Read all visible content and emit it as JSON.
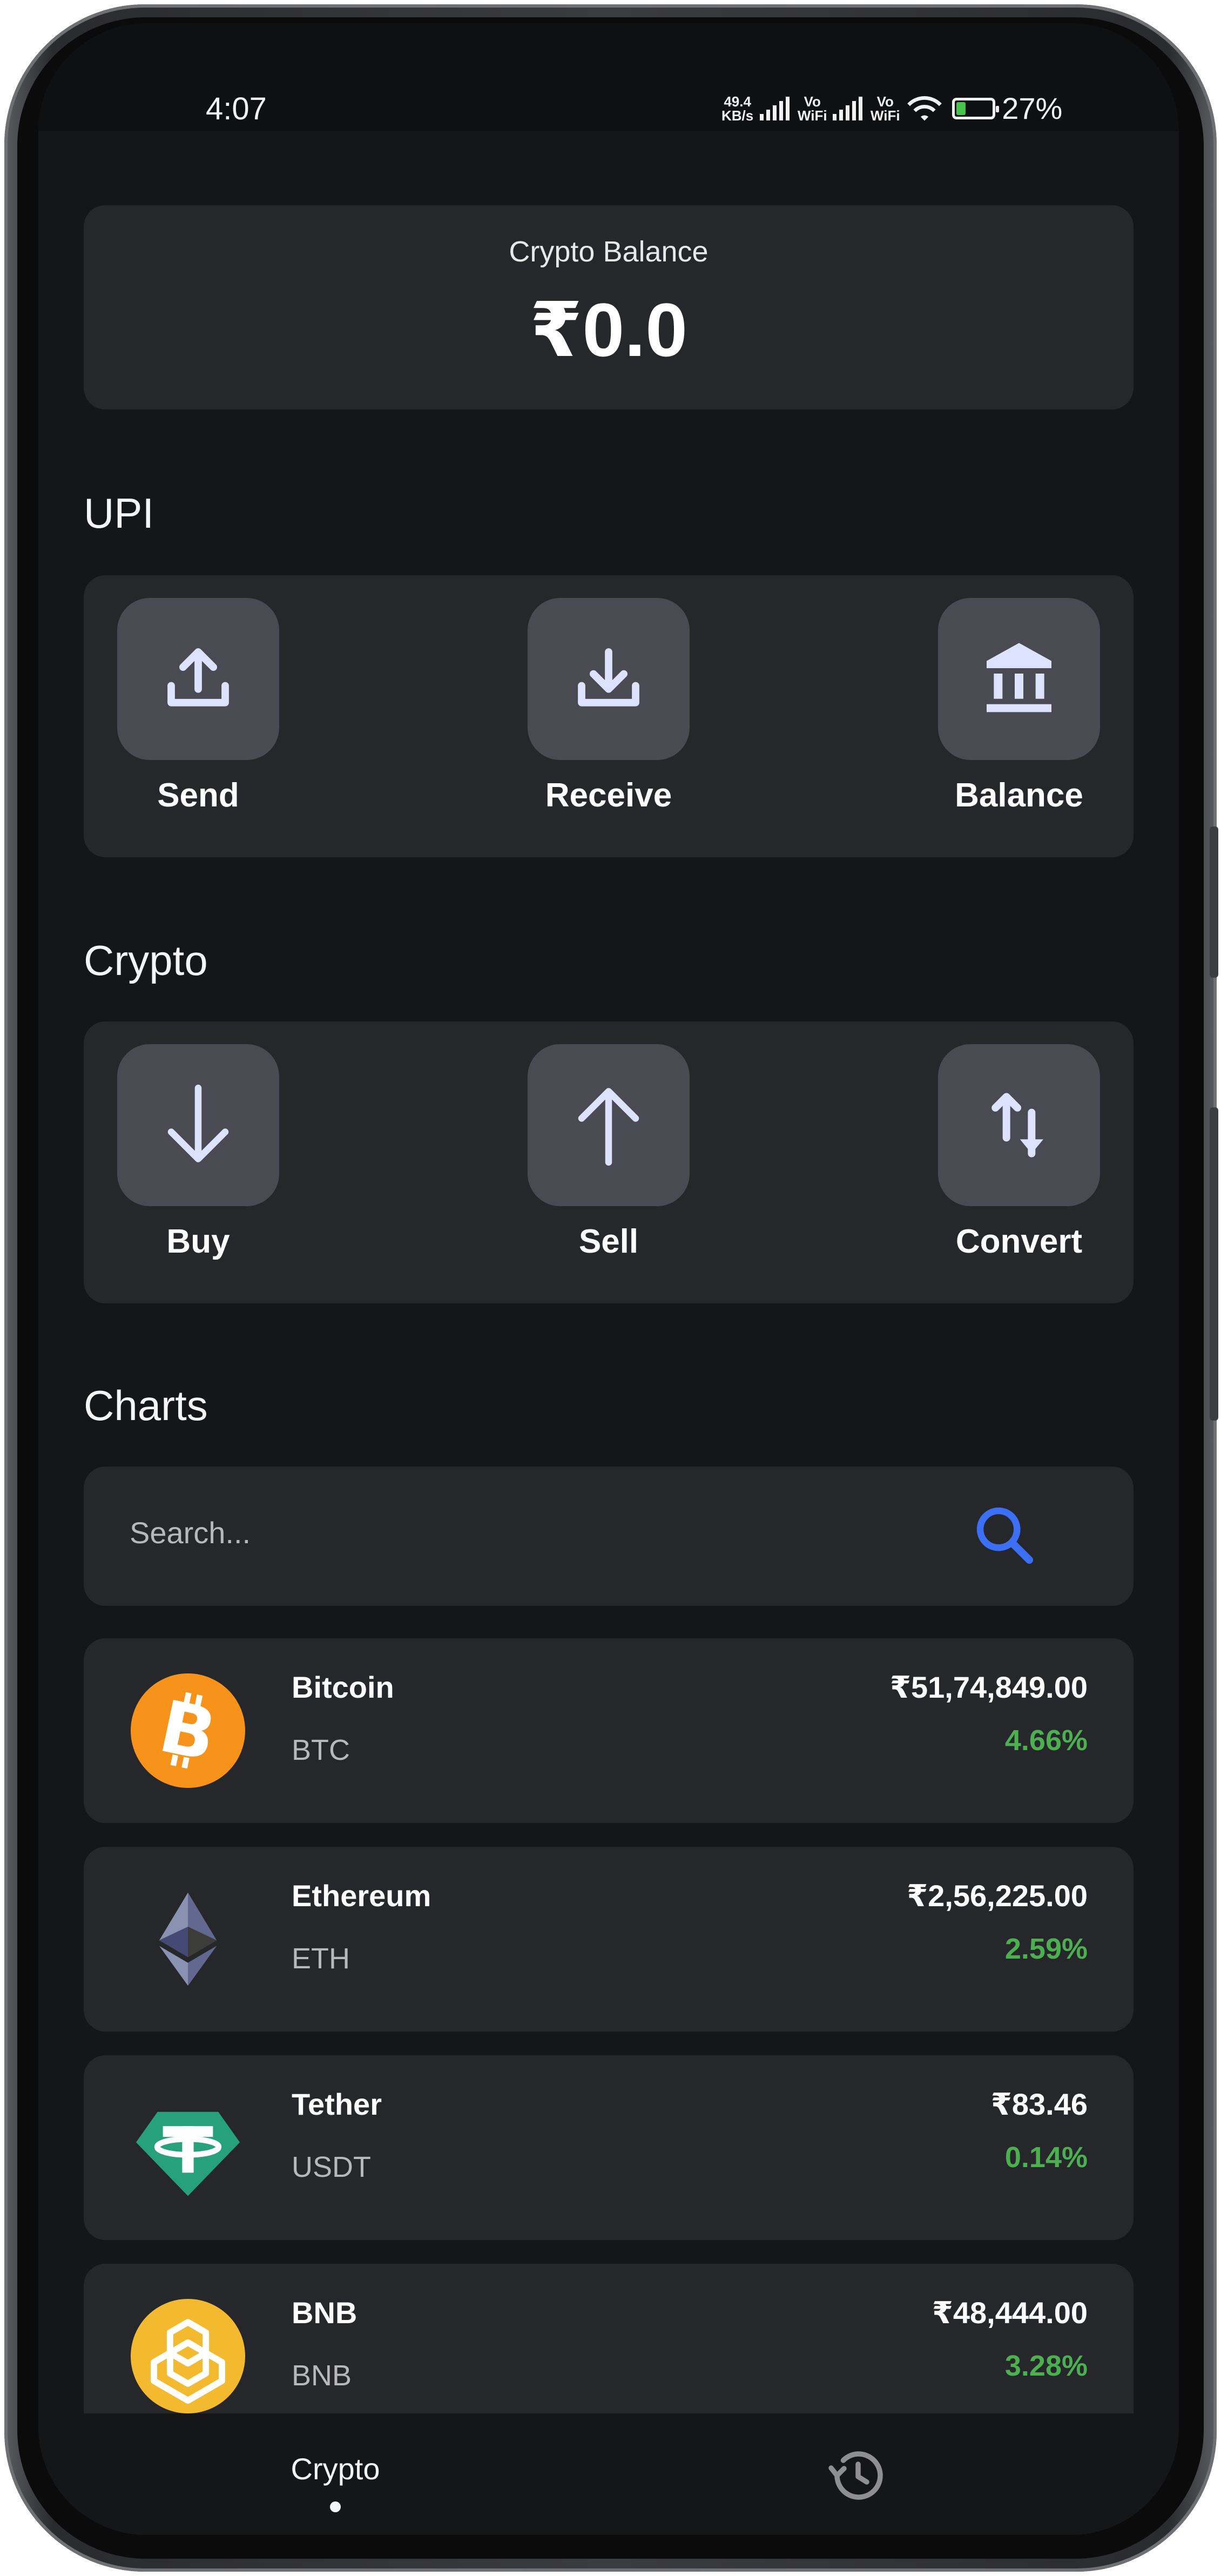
{
  "status_bar": {
    "time": "4:07",
    "net_speed_value": "49.4",
    "net_speed_unit": "KB/s",
    "sim1_label": "Vo WiFi",
    "sim2_label": "Vo WiFi",
    "battery_percent": "27%",
    "battery_level": 0.27
  },
  "balance": {
    "label": "Crypto Balance",
    "value": "₹0.0"
  },
  "upi": {
    "title": "UPI",
    "actions": [
      {
        "label": "Send",
        "icon": "upload-icon"
      },
      {
        "label": "Receive",
        "icon": "download-icon"
      },
      {
        "label": "Balance",
        "icon": "bank-icon"
      }
    ]
  },
  "crypto": {
    "title": "Crypto",
    "actions": [
      {
        "label": "Buy",
        "icon": "arrow-down-icon"
      },
      {
        "label": "Sell",
        "icon": "arrow-up-icon"
      },
      {
        "label": "Convert",
        "icon": "swap-vertical-icon"
      }
    ]
  },
  "charts": {
    "title": "Charts",
    "search_placeholder": "Search...",
    "coins": [
      {
        "name": "Bitcoin",
        "symbol": "BTC",
        "price": "₹51,74,849.00",
        "change": "4.66%",
        "icon": "bitcoin-icon"
      },
      {
        "name": "Ethereum",
        "symbol": "ETH",
        "price": "₹2,56,225.00",
        "change": "2.59%",
        "icon": "ethereum-icon"
      },
      {
        "name": "Tether",
        "symbol": "USDT",
        "price": "₹83.46",
        "change": "0.14%",
        "icon": "tether-icon"
      },
      {
        "name": "BNB",
        "symbol": "BNB",
        "price": "₹48,444.00",
        "change": "3.28%",
        "icon": "bnb-icon"
      }
    ]
  },
  "bottom_nav": {
    "crypto_label": "Crypto",
    "history_icon": "history-icon"
  },
  "colors": {
    "accent_blue": "#3b6ff5",
    "positive_green": "#4caf50",
    "bitcoin_orange": "#f7931a",
    "tether_teal": "#26a17b",
    "bnb_yellow": "#f3ba2f",
    "icon_tint": "#dde3ff"
  }
}
